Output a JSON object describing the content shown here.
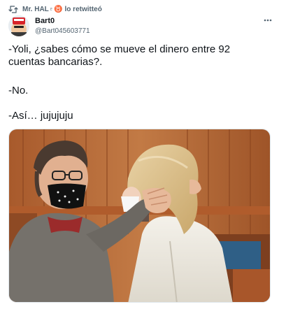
{
  "retweet": {
    "label": "Mr. HAL♇♉ lo retwitteó",
    "icon": "retweet-icon"
  },
  "author": {
    "display_name": "Bart0",
    "handle": "@Bart045603771",
    "avatar_icon": "avatar-image"
  },
  "menu": {
    "icon": "more-options-icon"
  },
  "tweet": {
    "lines": [
      "-Yoli, ¿sabes cómo se mueve el dinero entre 92",
      "cuentas bancarias?.",
      "-No.",
      "-Así… jujujuju"
    ]
  },
  "media": {
    "type": "photo"
  },
  "colors": {
    "text": "#0f1419",
    "muted": "#536471",
    "border": "#e1e8ed",
    "wood": "#b7693a"
  }
}
